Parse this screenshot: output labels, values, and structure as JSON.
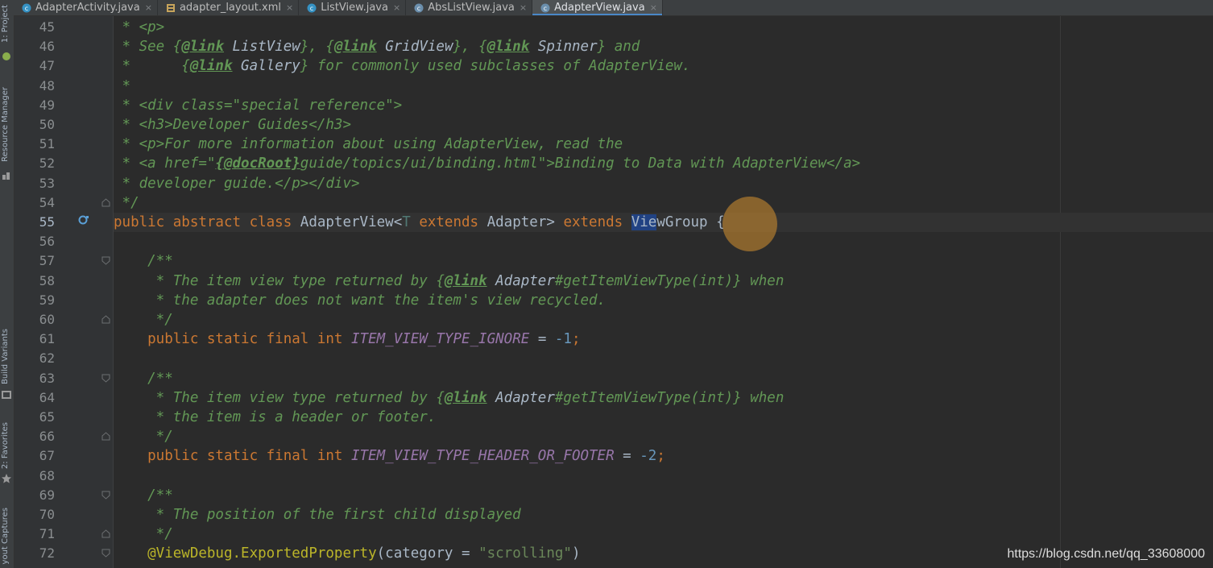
{
  "tabs": [
    {
      "label": "AdapterActivity.java",
      "icon": "java-class-icon",
      "active": false
    },
    {
      "label": "adapter_layout.xml",
      "icon": "xml-layout-icon",
      "active": false
    },
    {
      "label": "ListView.java",
      "icon": "java-class-icon",
      "active": false
    },
    {
      "label": "AbsListView.java",
      "icon": "java-abstract-class-icon",
      "active": false
    },
    {
      "label": "AdapterView.java",
      "icon": "java-abstract-class-icon",
      "active": true
    }
  ],
  "close_glyph": "×",
  "toolstrip": {
    "project": "1: Project",
    "resource_manager": "Resource Manager",
    "build_variants": "Build Variants",
    "favorites": "2: Favorites",
    "layout_captures": "yout Captures"
  },
  "line_numbers": [
    "45",
    "46",
    "47",
    "48",
    "49",
    "50",
    "51",
    "52",
    "53",
    "54",
    "55",
    "56",
    "57",
    "58",
    "59",
    "60",
    "61",
    "62",
    "63",
    "64",
    "65",
    "66",
    "67",
    "68",
    "69",
    "70",
    "71",
    "72"
  ],
  "current_line": "55",
  "code": {
    "l45": [
      {
        "t": " * ",
        "k": "c"
      },
      {
        "t": "<p>",
        "k": "c"
      }
    ],
    "l46": [
      {
        "t": " * See ",
        "k": "c"
      },
      {
        "t": "{",
        "k": "c"
      },
      {
        "t": "@link",
        "k": "ctag"
      },
      {
        "t": " ListView",
        "k": "cref"
      },
      {
        "t": "}, {",
        "k": "c"
      },
      {
        "t": "@link",
        "k": "ctag"
      },
      {
        "t": " GridView",
        "k": "cref"
      },
      {
        "t": "}, {",
        "k": "c"
      },
      {
        "t": "@link",
        "k": "ctag"
      },
      {
        "t": " Spinner",
        "k": "cref"
      },
      {
        "t": "} and",
        "k": "c"
      }
    ],
    "l47": [
      {
        "t": " *      {",
        "k": "c"
      },
      {
        "t": "@link",
        "k": "ctag"
      },
      {
        "t": " Gallery",
        "k": "cref"
      },
      {
        "t": "} for commonly used subclasses of AdapterView.",
        "k": "c"
      }
    ],
    "l48": [
      {
        "t": " *",
        "k": "c"
      }
    ],
    "l49": [
      {
        "t": " * <div class=\"special reference\">",
        "k": "c"
      }
    ],
    "l50": [
      {
        "t": " * <h3>Developer Guides</h3>",
        "k": "c"
      }
    ],
    "l51": [
      {
        "t": " * <p>For more information about using AdapterView, read the",
        "k": "c"
      }
    ],
    "l52": [
      {
        "t": " * <a href=\"",
        "k": "c"
      },
      {
        "t": "{@docRoot}",
        "k": "ctag"
      },
      {
        "t": "guide/topics/ui/binding.html\">Binding to Data with AdapterView</a>",
        "k": "c"
      }
    ],
    "l53": [
      {
        "t": " * developer guide.</p></div>",
        "k": "c"
      }
    ],
    "l54": [
      {
        "t": " */",
        "k": "c"
      }
    ],
    "l55": [
      {
        "t": "public abstract class ",
        "k": "kw"
      },
      {
        "t": "AdapterView<",
        "k": ""
      },
      {
        "t": "T ",
        "k": "tp"
      },
      {
        "t": "extends ",
        "k": "kw"
      },
      {
        "t": "Adapter> ",
        "k": ""
      },
      {
        "t": "extends ",
        "k": "kw"
      },
      {
        "t": "Vie",
        "k": "sel"
      },
      {
        "t": "wGroup {",
        "k": ""
      }
    ],
    "l56": [],
    "l57": [
      {
        "t": "    /**",
        "k": "c"
      }
    ],
    "l58": [
      {
        "t": "     * The item view type returned by {",
        "k": "c"
      },
      {
        "t": "@link",
        "k": "ctag"
      },
      {
        "t": " Adapter",
        "k": "cref"
      },
      {
        "t": "#getItemViewType(int)} when",
        "k": "c"
      }
    ],
    "l59": [
      {
        "t": "     * the adapter does not want the item's view recycled.",
        "k": "c"
      }
    ],
    "l60": [
      {
        "t": "     */",
        "k": "c"
      }
    ],
    "l61": [
      {
        "t": "    public static final int ",
        "k": "kw"
      },
      {
        "t": "ITEM_VIEW_TYPE_IGNORE",
        "k": "cst"
      },
      {
        "t": " = ",
        "k": ""
      },
      {
        "t": "-1",
        "k": "num"
      },
      {
        "t": ";",
        "k": "kw"
      }
    ],
    "l62": [],
    "l63": [
      {
        "t": "    /**",
        "k": "c"
      }
    ],
    "l64": [
      {
        "t": "     * The item view type returned by {",
        "k": "c"
      },
      {
        "t": "@link",
        "k": "ctag"
      },
      {
        "t": " Adapter",
        "k": "cref"
      },
      {
        "t": "#getItemViewType(int)} when",
        "k": "c"
      }
    ],
    "l65": [
      {
        "t": "     * the item is a header or footer.",
        "k": "c"
      }
    ],
    "l66": [
      {
        "t": "     */",
        "k": "c"
      }
    ],
    "l67": [
      {
        "t": "    public static final int ",
        "k": "kw"
      },
      {
        "t": "ITEM_VIEW_TYPE_HEADER_OR_FOOTER",
        "k": "cst"
      },
      {
        "t": " = ",
        "k": ""
      },
      {
        "t": "-2",
        "k": "num"
      },
      {
        "t": ";",
        "k": "kw"
      }
    ],
    "l68": [],
    "l69": [
      {
        "t": "    /**",
        "k": "c"
      }
    ],
    "l70": [
      {
        "t": "     * The position of the first child displayed",
        "k": "c"
      }
    ],
    "l71": [
      {
        "t": "     */",
        "k": "c"
      }
    ],
    "l72": [
      {
        "t": "    @ViewDebug.ExportedProperty",
        "k": "ann"
      },
      {
        "t": "(category = ",
        "k": ""
      },
      {
        "t": "\"scrolling\"",
        "k": "str"
      },
      {
        "t": ")",
        "k": ""
      }
    ]
  },
  "watermark": "https://blog.csdn.net/qq_33608000",
  "colors": {
    "background": "#2b2b2b",
    "keyword": "#cc7832",
    "comment": "#629755",
    "constant": "#9876aa",
    "number": "#6897bb",
    "string": "#6a8759",
    "annotation": "#bbb529",
    "selection": "#214283",
    "cursor_highlight": "#d69130"
  }
}
